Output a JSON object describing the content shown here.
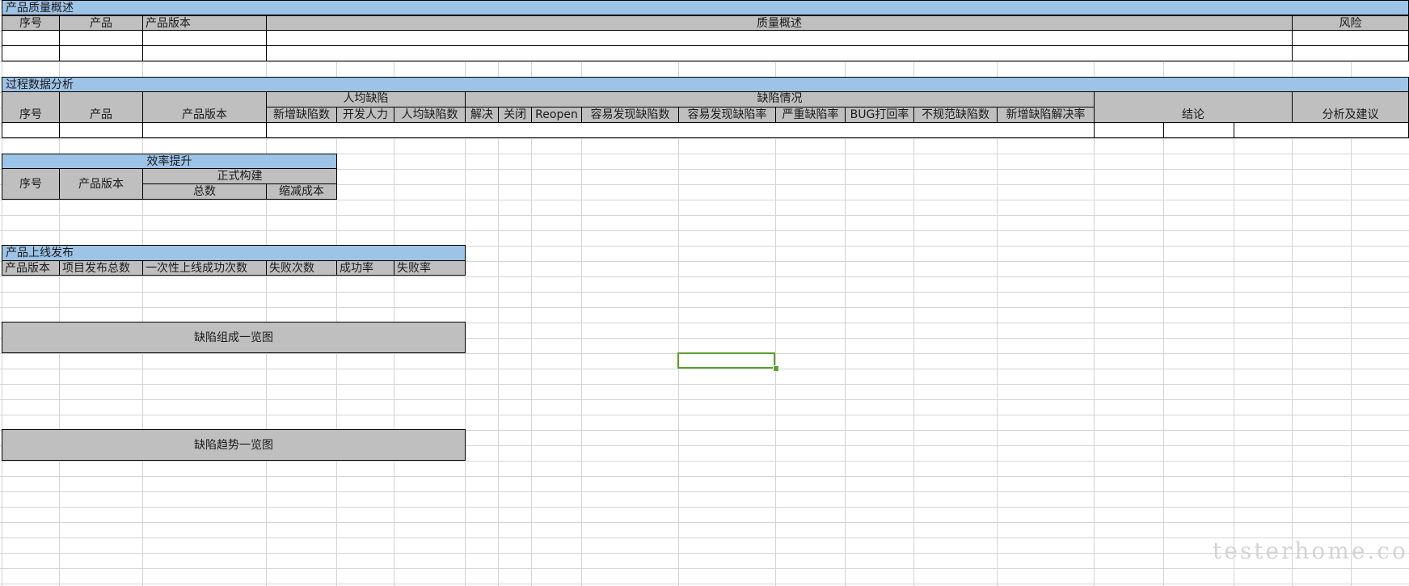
{
  "sheet": {
    "quality_overview": {
      "title": "产品质量概述",
      "headers": [
        "序号",
        "产品",
        "产品版本",
        "质量概述",
        "风险"
      ]
    },
    "process_analysis": {
      "title": "过程数据分析",
      "group_per_capita": "人均缺陷",
      "group_defects": "缺陷情况",
      "headers": [
        "序号",
        "产品",
        "产品版本",
        "结论",
        "分析及建议"
      ],
      "sub_headers": [
        "新增缺陷数",
        "开发人力",
        "人均缺陷数",
        "解决",
        "关闭",
        "Reopen",
        "容易发现缺陷数",
        "容易发现缺陷率",
        "严重缺陷率",
        "BUG打回率",
        "不规范缺陷数",
        "新增缺陷解决率"
      ]
    },
    "efficiency": {
      "title": "效率提升",
      "group_build": "正式构建",
      "headers": [
        "序号",
        "产品版本"
      ],
      "sub_headers": [
        "总数",
        "缩减成本"
      ]
    },
    "release": {
      "title": "产品上线发布",
      "headers": [
        "产品版本",
        "项目发布总数",
        "一次性上线成功次数",
        "失败次数",
        "成功率",
        "失败率"
      ]
    },
    "charts": {
      "defect_composition": "缺陷组成一览图",
      "defect_trend": "缺陷趋势一览图"
    },
    "colors": {
      "section_header": "#9dc3e6",
      "column_header": "#bfbfbf",
      "selection": "#5aa02c",
      "gridline": "#d4d4d4"
    }
  },
  "watermark": "testerhome.com"
}
